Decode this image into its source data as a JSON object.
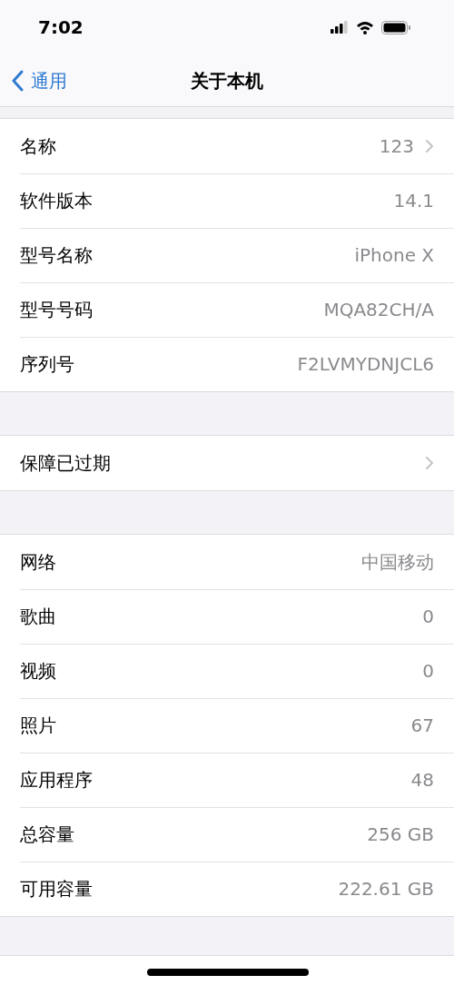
{
  "status_bar": {
    "time": "7:02"
  },
  "nav": {
    "back": "通用",
    "title": "关于本机"
  },
  "groups": [
    {
      "rows": [
        {
          "label": "名称",
          "value": "123",
          "disclosure": true
        },
        {
          "label": "软件版本",
          "value": "14.1",
          "disclosure": false
        },
        {
          "label": "型号名称",
          "value": "iPhone X",
          "disclosure": false
        },
        {
          "label": "型号号码",
          "value": "MQA82CH/A",
          "disclosure": false
        },
        {
          "label": "序列号",
          "value": "F2LVMYDNJCL6",
          "disclosure": false
        }
      ]
    },
    {
      "rows": [
        {
          "label": "保障已过期",
          "disclosure": true
        }
      ]
    },
    {
      "rows": [
        {
          "label": "网络",
          "value": "中国移动",
          "disclosure": false
        },
        {
          "label": "歌曲",
          "value": "0",
          "disclosure": false
        },
        {
          "label": "视频",
          "value": "0",
          "disclosure": false
        },
        {
          "label": "照片",
          "value": "67",
          "disclosure": false
        },
        {
          "label": "应用程序",
          "value": "48",
          "disclosure": false
        },
        {
          "label": "总容量",
          "value": "256 GB",
          "disclosure": false
        },
        {
          "label": "可用容量",
          "value": "222.61 GB",
          "disclosure": false
        }
      ]
    }
  ]
}
